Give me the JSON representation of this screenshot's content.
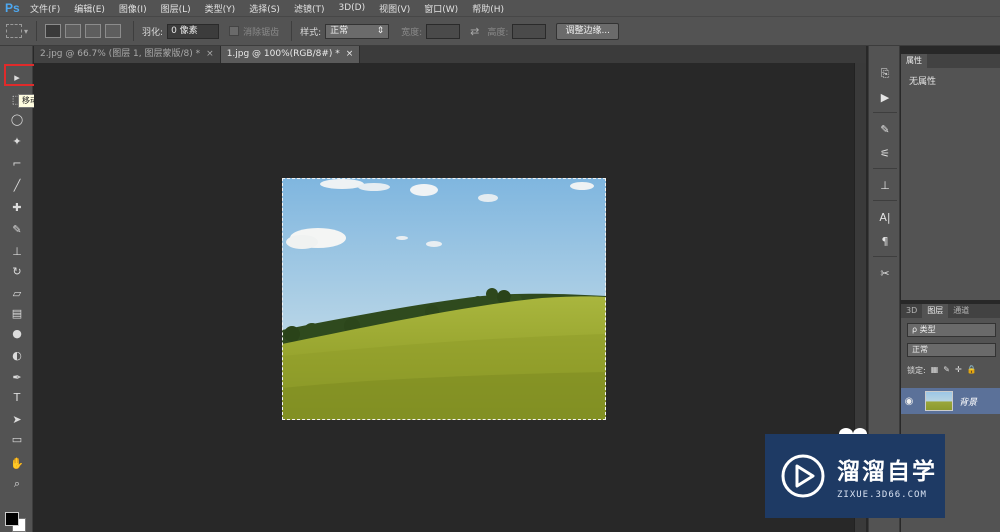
{
  "app": {
    "logo": "Ps"
  },
  "menu": [
    "文件(F)",
    "编辑(E)",
    "图像(I)",
    "图层(L)",
    "类型(Y)",
    "选择(S)",
    "滤镜(T)",
    "3D(D)",
    "视图(V)",
    "窗口(W)",
    "帮助(H)"
  ],
  "options": {
    "feather_label": "羽化:",
    "feather_value": "0 像素",
    "antialias_label": "消除锯齿",
    "style_label": "样式:",
    "style_value": "正常",
    "width_label": "宽度:",
    "height_label": "高度:",
    "refine_button": "调整边缘..."
  },
  "tabs": [
    {
      "label": "2.jpg @ 66.7% (图层 1, 图层蒙版/8) *",
      "close": "×",
      "active": false
    },
    {
      "label": "1.jpg @ 100%(RGB/8#) *",
      "close": "×",
      "active": true
    }
  ],
  "tooltip": "移动工具 (V)",
  "panels": {
    "properties_tab": "属性",
    "properties_text": "无属性",
    "layer_tabs": [
      "3D",
      "图层",
      "通道"
    ],
    "filter_label": "ρ 类型",
    "blend_mode": "正常",
    "lock_label": "锁定:",
    "layer_name": "背景"
  },
  "watermark": {
    "title": "溜溜自学",
    "subtitle": "ZIXUE.3D66.COM"
  },
  "colors": {
    "accent": "#4ea8f0",
    "highlight": "#e02b2b",
    "selected_layer": "#5b7199",
    "watermark_bg": "#1e3a64"
  }
}
